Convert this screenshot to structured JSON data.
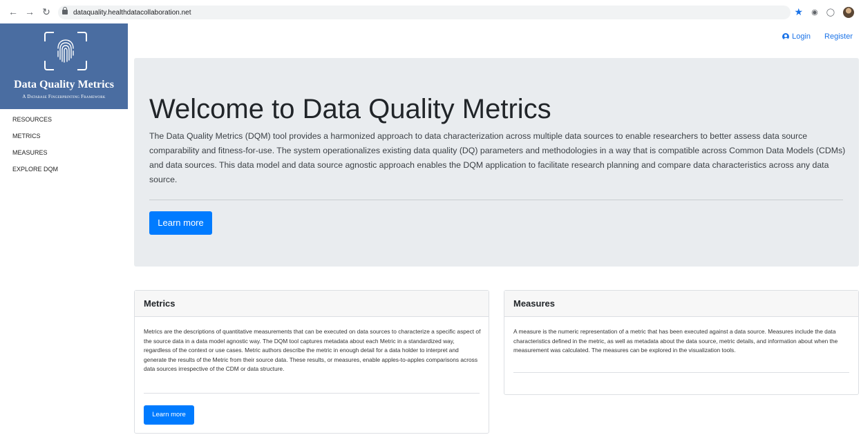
{
  "browser": {
    "url": "dataquality.healthdatacollaboration.net"
  },
  "brand": {
    "title": "Data Quality Metrics",
    "subtitle": "A Database Fingerprinting Framework"
  },
  "sidebar": {
    "items": [
      {
        "label": "RESOURCES"
      },
      {
        "label": "METRICS"
      },
      {
        "label": "MEASURES"
      },
      {
        "label": "EXPLORE DQM"
      }
    ]
  },
  "topnav": {
    "login_label": "Login",
    "register_label": "Register"
  },
  "jumbotron": {
    "title": "Welcome to Data Quality Metrics",
    "text": "The Data Quality Metrics (DQM) tool provides a harmonized approach to data characterization across multiple data sources to enable researchers to better assess data source comparability and fitness-for-use. The system operationalizes existing data quality (DQ) parameters and methodologies in a way that is compatible across Common Data Models (CDMs) and data sources. This data model and data source agnostic approach enables the DQM application to facilitate research planning and compare data characteristics across any data source.",
    "button_label": "Learn more"
  },
  "cards": {
    "metrics": {
      "title": "Metrics",
      "text": "Metrics are the descriptions of quantitative measurements that can be executed on data sources to characterize a specific aspect of the source data in a data model agnostic way. The DQM tool captures metadata about each Metric in a standardized way, regardless of the context or use cases. Metric authors describe the metric in enough detail for a data holder to interpret and generate the results of the Metric from their source data. These results, or measures, enable apples-to-apples comparisons across data sources irrespective of the CDM or data structure.",
      "button_label": "Learn more"
    },
    "measures": {
      "title": "Measures",
      "text": "A measure is the numeric representation of a metric that has been executed against a data source. Measures include the data characteristics defined in the metric, as well as metadata about the data source, metric details, and information about when the measurement was calculated. The measures can be explored in the visualization tools."
    }
  }
}
